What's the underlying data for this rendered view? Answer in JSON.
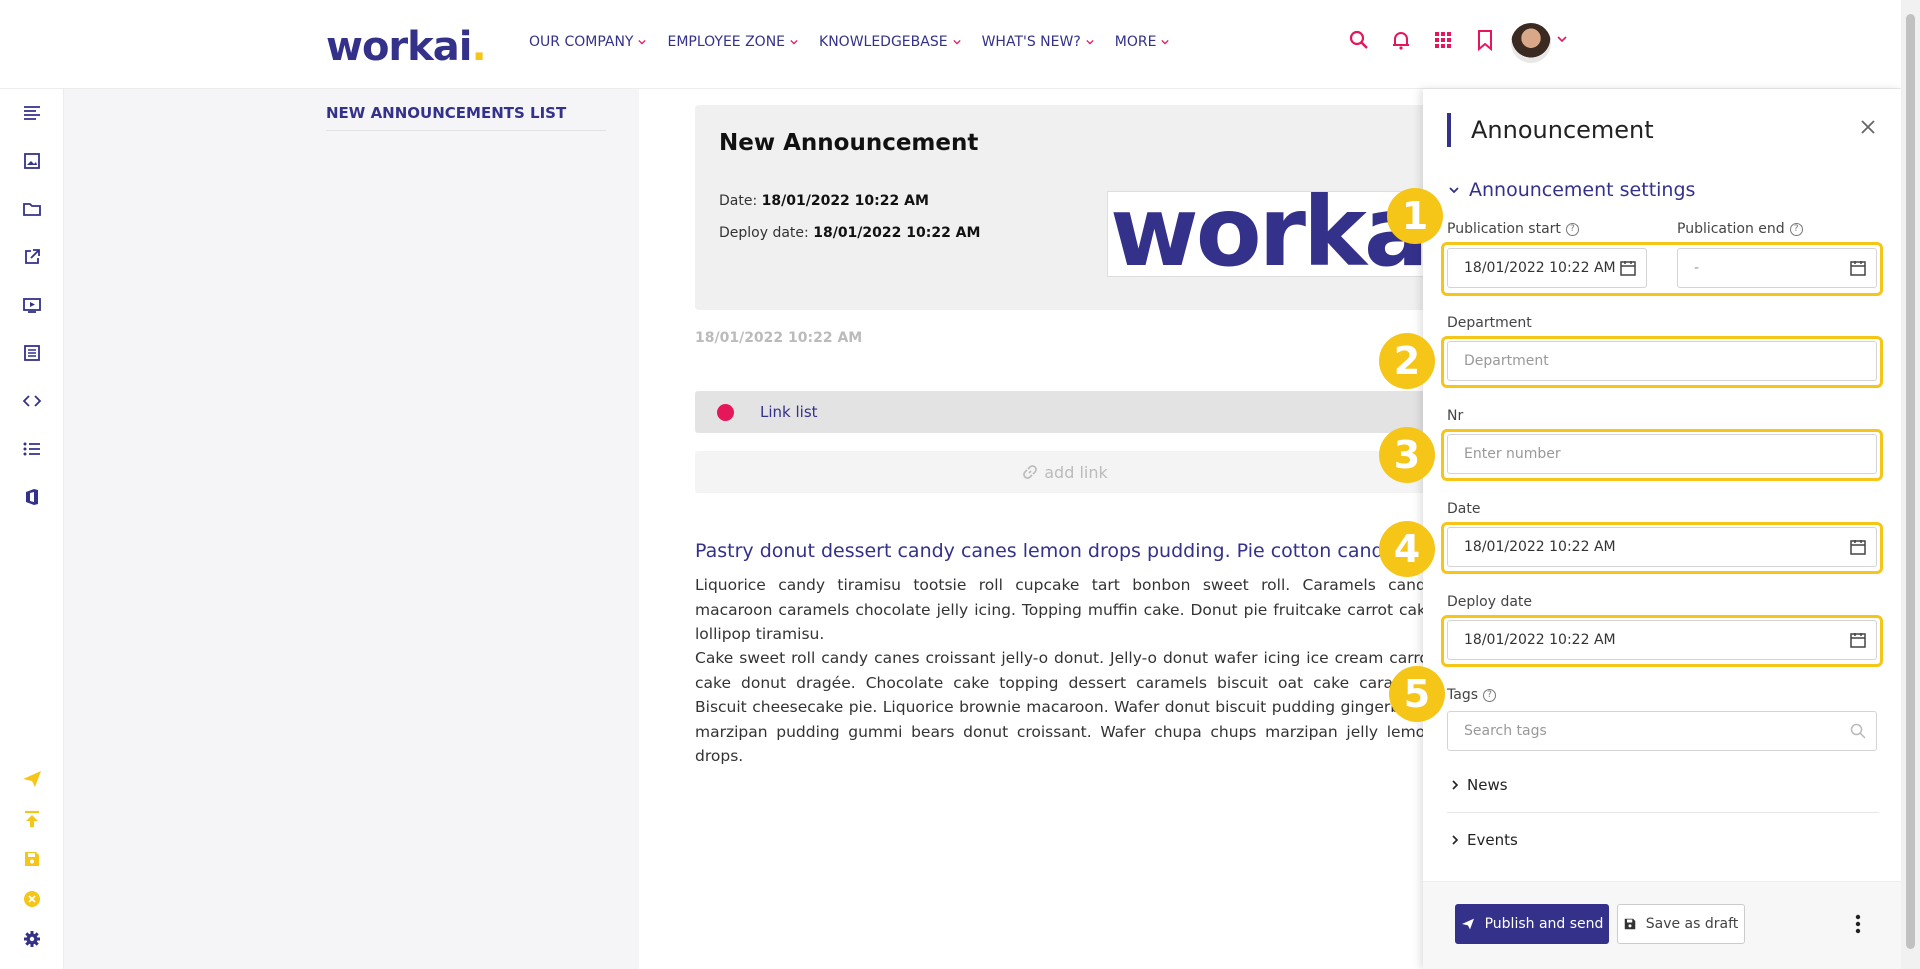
{
  "brand": {
    "name": "workai",
    "dot": ".",
    "color": "#34318b",
    "accent": "#f5c518"
  },
  "nav": {
    "items": [
      {
        "label": "OUR COMPANY"
      },
      {
        "label": "EMPLOYEE ZONE"
      },
      {
        "label": "KNOWLEDGEBASE"
      },
      {
        "label": "WHAT'S NEW?"
      },
      {
        "label": "MORE"
      }
    ],
    "icons": [
      "search-icon",
      "bell-icon",
      "apps-grid-icon",
      "bookmark-icon"
    ]
  },
  "list": {
    "title": "NEW ANNOUNCEMENTS LIST"
  },
  "preview": {
    "title": "New Announcement",
    "date_label": "Date:",
    "date_value": "18/01/2022 10:22 AM",
    "deploy_label": "Deploy date:",
    "deploy_value": "18/01/2022 10:22 AM",
    "logo_text": "workai",
    "meta_date": "18/01/2022 10:22 AM",
    "link_list_label": "Link list",
    "add_link_label": "add link",
    "article_title": "Pastry donut dessert candy canes lemon drops pudding. Pie cotton candy",
    "paragraph_1": "Liquorice candy tiramisu tootsie roll cupcake tart bonbon sweet roll. Caramels candy macaroon caramels chocolate jelly icing. Topping muffin cake. Donut pie fruitcake carrot cake lollipop tiramisu.",
    "paragraph_2": "Cake sweet roll candy canes croissant jelly-o donut. Jelly-o donut wafer icing ice cream carrot cake donut dragée. Chocolate cake topping dessert caramels biscuit oat cake caramels. Biscuit cheesecake pie. Liquorice brownie macaroon. Wafer donut biscuit pudding gingerbread marzipan pudding gummi bears donut croissant. Wafer chupa chups marzipan jelly lemon drops."
  },
  "panel": {
    "title": "Announcement",
    "section": "Announcement settings",
    "publication_start": {
      "label": "Publication start",
      "value": "18/01/2022 10:22 AM"
    },
    "publication_end": {
      "label": "Publication end",
      "value": "-"
    },
    "department": {
      "label": "Department",
      "placeholder": "Department"
    },
    "nr": {
      "label": "Nr",
      "placeholder": "Enter number"
    },
    "date": {
      "label": "Date",
      "value": "18/01/2022 10:22 AM"
    },
    "deploy_date": {
      "label": "Deploy date",
      "value": "18/01/2022 10:22 AM"
    },
    "tags": {
      "label": "Tags",
      "placeholder": "Search tags"
    },
    "collapsibles": [
      {
        "label": "News"
      },
      {
        "label": "Events"
      }
    ],
    "badges": [
      "1",
      "2",
      "3",
      "4",
      "5"
    ],
    "publish_label": "Publish and send",
    "draft_label": "Save as draft"
  }
}
